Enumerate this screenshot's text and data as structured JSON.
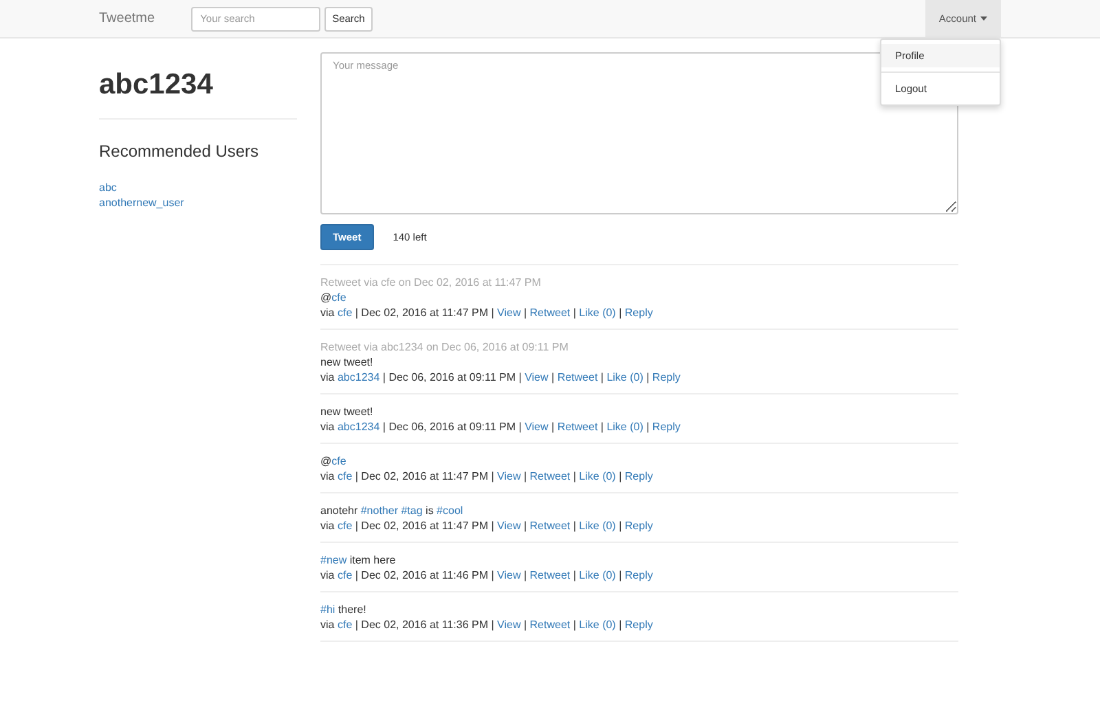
{
  "navbar": {
    "brand": "Tweetme",
    "search": {
      "placeholder": "Your search"
    },
    "search_button": "Search",
    "account_menu": {
      "label": "Account",
      "expanded": true,
      "items": [
        {
          "label": "Profile",
          "selected": true
        },
        {
          "label": "Logout",
          "selected": false
        }
      ]
    }
  },
  "profile": {
    "username": "abc1234",
    "recommended_title": "Recommended Users",
    "recommended_users": [
      "abc",
      "anothernew_user"
    ]
  },
  "composer": {
    "placeholder": "Your message",
    "button": "Tweet",
    "remaining": "140 left"
  },
  "separator": "|",
  "tweets": [
    {
      "retweet_note": "Retweet via cfe on Dec 02, 2016 at 11:47 PM",
      "content": [
        {
          "kind": "text",
          "text": "@"
        },
        {
          "kind": "link",
          "text": "cfe"
        }
      ],
      "via": "via",
      "user": "cfe",
      "date": "Dec 02, 2016 at 11:47 PM",
      "actions": [
        "View",
        "Retweet",
        "Like (0)",
        "Reply"
      ]
    },
    {
      "retweet_note": "Retweet via abc1234 on Dec 06, 2016 at 09:11 PM",
      "content": [
        {
          "kind": "text",
          "text": "new tweet!"
        }
      ],
      "via": "via",
      "user": "abc1234",
      "date": "Dec 06, 2016 at 09:11 PM",
      "actions": [
        "View",
        "Retweet",
        "Like (0)",
        "Reply"
      ]
    },
    {
      "content": [
        {
          "kind": "text",
          "text": "new tweet!"
        }
      ],
      "via": "via",
      "user": "abc1234",
      "date": "Dec 06, 2016 at 09:11 PM",
      "actions": [
        "View",
        "Retweet",
        "Like (0)",
        "Reply"
      ]
    },
    {
      "content": [
        {
          "kind": "text",
          "text": "@"
        },
        {
          "kind": "link",
          "text": "cfe"
        }
      ],
      "via": "via",
      "user": "cfe",
      "date": "Dec 02, 2016 at 11:47 PM",
      "actions": [
        "View",
        "Retweet",
        "Like (0)",
        "Reply"
      ]
    },
    {
      "content": [
        {
          "kind": "text",
          "text": "anotehr "
        },
        {
          "kind": "link",
          "text": "#nother"
        },
        {
          "kind": "link",
          "text": "#tag"
        },
        {
          "kind": "text",
          "text": " is "
        },
        {
          "kind": "link",
          "text": "#cool"
        }
      ],
      "via": "via",
      "user": "cfe",
      "date": "Dec 02, 2016 at 11:47 PM",
      "actions": [
        "View",
        "Retweet",
        "Like (0)",
        "Reply"
      ]
    },
    {
      "content": [
        {
          "kind": "link",
          "text": "#new"
        },
        {
          "kind": "text",
          "text": " item here"
        }
      ],
      "via": "via",
      "user": "cfe",
      "date": "Dec 02, 2016 at 11:46 PM",
      "actions": [
        "View",
        "Retweet",
        "Like (0)",
        "Reply"
      ]
    },
    {
      "content": [
        {
          "kind": "link",
          "text": "#hi"
        },
        {
          "kind": "text",
          "text": " there!"
        }
      ],
      "via": "via",
      "user": "cfe",
      "date": "Dec 02, 2016 at 11:36 PM",
      "actions": [
        "View",
        "Retweet",
        "Like (0)",
        "Reply"
      ]
    }
  ]
}
